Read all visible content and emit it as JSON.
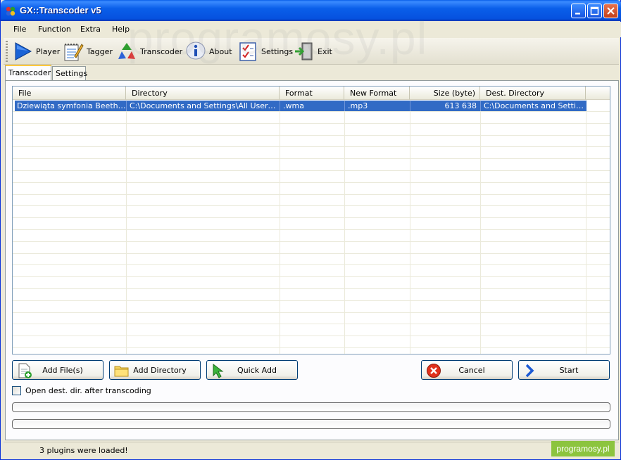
{
  "window": {
    "title": "GX::Transcoder v5"
  },
  "menu": [
    "File",
    "Function",
    "Extra",
    "Help"
  ],
  "toolbar": {
    "player": "Player",
    "tagger": "Tagger",
    "transcoder": "Transcoder",
    "about": "About",
    "settings": "Settings",
    "exit": "Exit"
  },
  "tabs": {
    "transcoder": "Transcoder",
    "settings": "Settings"
  },
  "grid": {
    "columns": [
      "File",
      "Directory",
      "Format",
      "New Format",
      "Size (byte)",
      "Dest. Directory"
    ],
    "rows": [
      {
        "file": "Dziewiąta symfonia Beethove...",
        "directory": "C:\\Documents and Settings\\All Users\\Do...",
        "format": ".wma",
        "new_format": ".mp3",
        "size": "613 638",
        "dest": "C:\\Documents and Setting..."
      }
    ]
  },
  "buttons": {
    "add_files": "Add File(s)",
    "add_directory": "Add Directory",
    "quick_add": "Quick Add",
    "cancel": "Cancel",
    "start": "Start"
  },
  "options": {
    "open_dest_label": "Open dest. dir. after transcoding",
    "open_dest_checked": false
  },
  "progress": {
    "bar1": 0,
    "bar2": 0
  },
  "status": {
    "text": "3 plugins were loaded!"
  },
  "watermark": {
    "badge": "programosy.pl",
    "background": "programosy.pl"
  },
  "colors": {
    "title_blue": "#0a5fe9",
    "selection": "#316ac5",
    "badge_green": "#8cc43e"
  }
}
